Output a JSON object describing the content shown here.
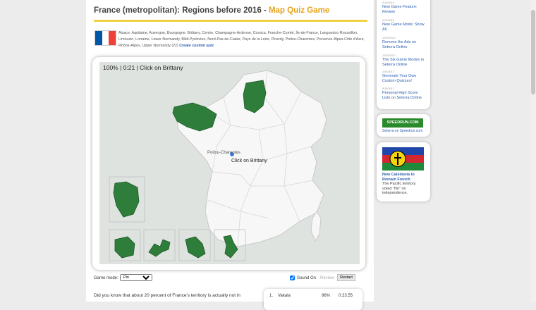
{
  "header": {
    "title": "France (metropolitan): Regions before 2016",
    "separator": " - ",
    "subtitle": "Map Quiz Game"
  },
  "flag_colors": [
    "#0055a4",
    "#ffffff",
    "#ef4135"
  ],
  "regions_text": "Alsace, Aquitaine, Auvergne, Bourgogne, Brittany, Centre, Champagne-Ardenne, Corsica, Franche-Comté, Île-de-France, Languedoc-Roussillon, Limousin, Lorraine, Lower Normandy, Midi-Pyrénées, Nord-Pas-de-Calais, Pays de la Loire, Picardy, Poitou-Charentes, Provence-Alpes-Côte d'Azur, Rhône-Alpes, Upper Normandy  (22)",
  "create_custom_quiz": "Create custom quiz",
  "game": {
    "status_score": "100%",
    "status_time": "0:21",
    "status_prompt": "Click on Brittany",
    "label_poitou": "Poitou-Charentes",
    "cursor_tooltip": "Click on Brittany"
  },
  "colors": {
    "correct": "#2e7d3a",
    "land": "#f7f7f7",
    "sea": "#dfe3e0",
    "border": "#c8c8c8",
    "link": "#2a5db0",
    "accent": "#e8a21a"
  },
  "controls": {
    "game_mode_label": "Game mode:",
    "game_mode_value": "Pin",
    "sound_label": "Sound On",
    "review_label": "Review",
    "restart_label": "Restart"
  },
  "fact": "Did you know that about 20 percent of France's territory is actually not in",
  "leaderboard": [
    {
      "rank": "1.",
      "name": "Vakala",
      "pct": "96%",
      "time": "0:23.55"
    }
  ],
  "sidebar": {
    "news": [
      {
        "date": "4/10/2018",
        "title": "New Game Feature: Review"
      },
      {
        "date": "4/10/2018",
        "title": "New Game Mode: Show All"
      },
      {
        "date": "12/18/2017",
        "title": "Remove the Ads on Seterra Online"
      },
      {
        "date": "12/16/2017",
        "title": "The Six Game Modes in Seterra Online"
      },
      {
        "date": "10/4/2017",
        "title": "Generate Your Own Custom Quizzes!"
      },
      {
        "date": "8/29/2017",
        "title": "Personal High Score Lists on Seterra Online"
      }
    ],
    "speedrun_logo": "SPEEDRUN.COM",
    "speedrun_caption": "Seterra on Speedrun.com",
    "nc_title": "New Caledonia to Remain French",
    "nc_text": "The Pacific territory voted \"No\" on independence."
  }
}
